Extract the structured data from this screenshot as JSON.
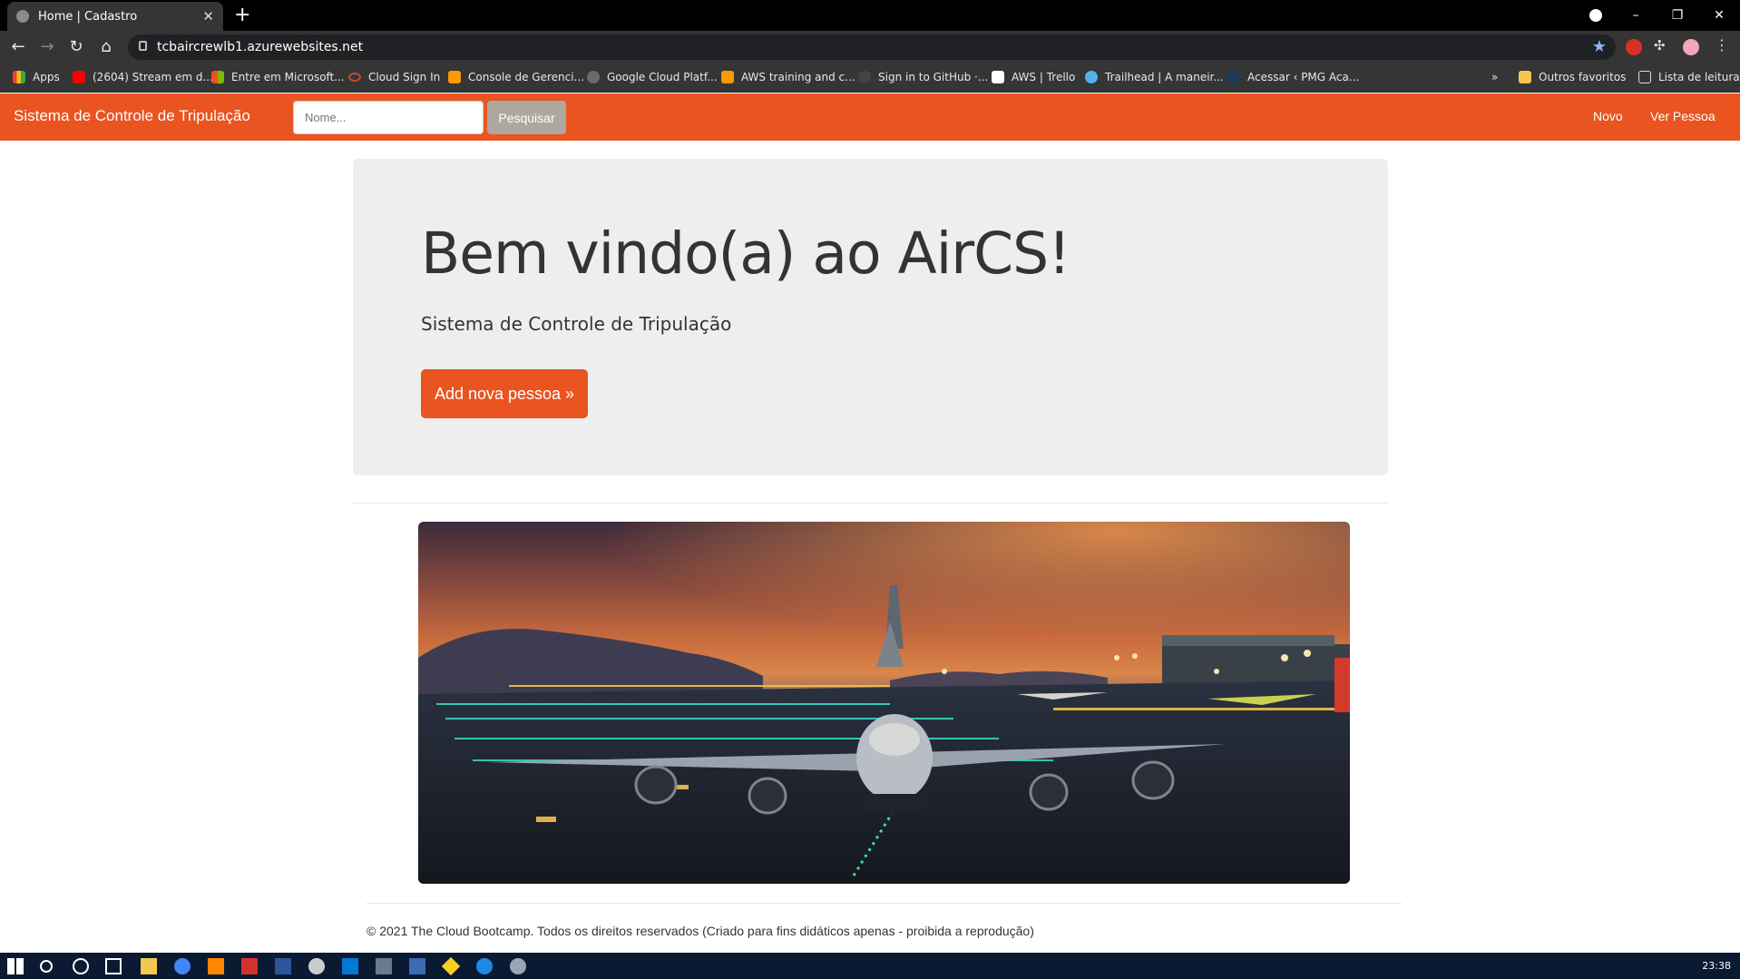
{
  "browser": {
    "tab_title": "Home | Cadastro",
    "tab_close": "✕",
    "new_tab": "+",
    "url": "tcbaircrewlb1.azurewebsites.net",
    "window_controls": [
      "–",
      "❐",
      "✕"
    ],
    "bookmarks": [
      {
        "label": "Apps",
        "color": "#ea4335"
      },
      {
        "label": "(2604) Stream em d...",
        "color": "#ff0000"
      },
      {
        "label": "Entre em Microsoft...",
        "color": "#f25022"
      },
      {
        "label": "Cloud Sign In",
        "color": "#c74634"
      },
      {
        "label": "Console de Gerenci...",
        "color": "#ff9900"
      },
      {
        "label": "Google Cloud Platf...",
        "color": "#777777"
      },
      {
        "label": "AWS training and c...",
        "color": "#ff9900"
      },
      {
        "label": "Sign in to GitHub ·...",
        "color": "#444444"
      },
      {
        "label": "AWS | Trello",
        "color": "#ffffff"
      },
      {
        "label": "Trailhead | A maneir...",
        "color": "#4fb3e8"
      },
      {
        "label": "Acessar ‹ PMG Aca...",
        "color": "#1f3a57"
      }
    ],
    "bookmarks_more": "»",
    "other_favorites": "Outros favoritos",
    "reading_list": "Lista de leitura"
  },
  "navbar": {
    "brand": "Sistema de Controle de Tripulação",
    "search_placeholder": "Nome...",
    "search_button": "Pesquisar",
    "links": [
      "Novo",
      "Ver Pessoa"
    ],
    "color": "#e95420"
  },
  "jumbotron": {
    "title": "Bem vindo(a) ao AirCS!",
    "lead": "Sistema de Controle de Tripulação",
    "button": "Add nova pessoa »"
  },
  "hero_image": {
    "icon": "airplane-runway-sunset-image"
  },
  "footer": {
    "text": "© 2021 The Cloud Bootcamp. Todos os direitos reservados (Criado para fins didáticos apenas - proibida a reprodução)"
  },
  "taskbar": {
    "clock": "23:38"
  }
}
